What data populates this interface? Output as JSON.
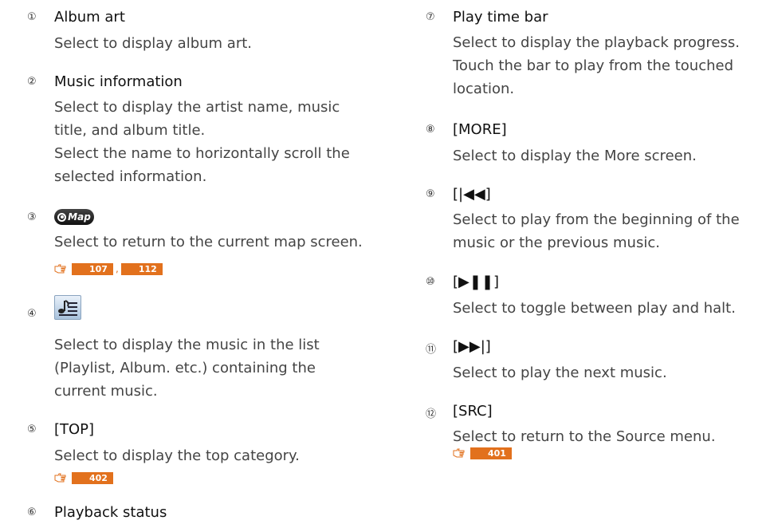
{
  "items": [
    {
      "num": "①",
      "title": "Album art",
      "desc": [
        "Select to display album art."
      ]
    },
    {
      "num": "②",
      "title": "Music information",
      "desc": [
        "Select to display the artist name, music",
        "title, and album title.",
        "Select the name to horizontally scroll the",
        "selected information."
      ]
    },
    {
      "num": "③",
      "icon": "map-icon",
      "icon_label": "Map",
      "desc": [
        "Select to return to the current map screen."
      ],
      "refs": [
        "107",
        "112"
      ]
    },
    {
      "num": "④",
      "icon": "music-list-icon",
      "desc": [
        "Select to display the music in the list",
        "(Playlist, Album. etc.) containing the",
        "current music."
      ]
    },
    {
      "num": "⑤",
      "title": "[TOP]",
      "desc": [
        "Select to display the top category."
      ],
      "refs": [
        "402"
      ]
    },
    {
      "num": "⑥",
      "title": "Playback status"
    },
    {
      "num": "⑦",
      "title": "Play time bar",
      "desc": [
        "Select to display the playback progress.",
        "Touch the bar to play from the touched",
        "location."
      ]
    },
    {
      "num": "⑧",
      "title": "[MORE]",
      "desc": [
        "Select to display the More screen."
      ]
    },
    {
      "num": "⑨",
      "title": "[|◀◀]",
      "desc": [
        "Select to play from the beginning of the",
        "music or the previous music."
      ]
    },
    {
      "num": "⑩",
      "title": "[▶❚❚]",
      "desc": [
        "Select to toggle between play and halt."
      ]
    },
    {
      "num": "⑪",
      "title": "[▶▶|]",
      "desc": [
        "Select to play the next music."
      ]
    },
    {
      "num": "⑫",
      "title": "[SRC]",
      "desc": [
        "Select to return to the Source menu."
      ],
      "refs": [
        "401"
      ]
    }
  ],
  "ref_separator": ",",
  "colors": {
    "ref_badge": "#e2711d",
    "text": "#444444"
  }
}
